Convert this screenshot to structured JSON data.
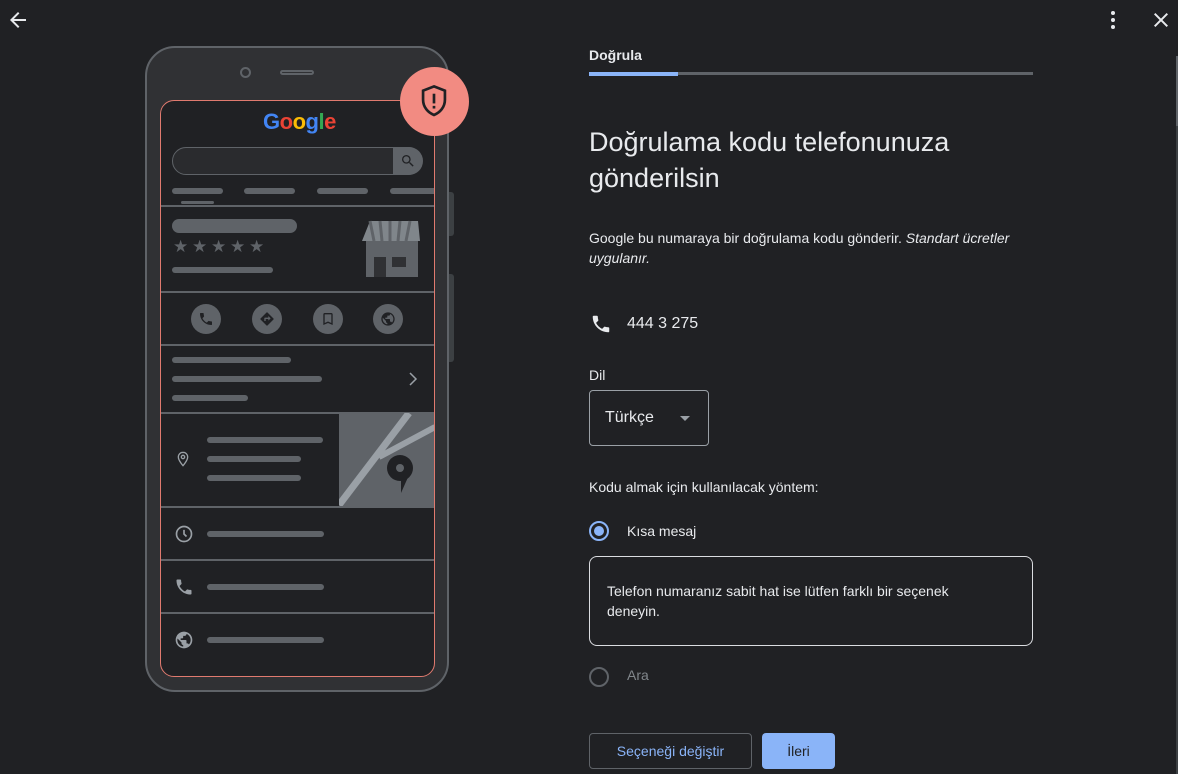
{
  "window": {
    "back_icon": "arrow-left-icon",
    "more_icon": "more-vert-icon",
    "close_icon": "close-icon"
  },
  "illustration": {
    "logo_text": [
      "G",
      "o",
      "o",
      "g",
      "l",
      "e"
    ],
    "logo_colors": [
      "#4285f4",
      "#ea4335",
      "#fbbc05",
      "#4285f4",
      "#34a853",
      "#ea4335"
    ],
    "stars": [
      "★",
      "★",
      "★",
      "★",
      "★"
    ],
    "badge_icon": "shield-icon",
    "badge_color": "#f28b82",
    "frame_color": "#e07a6f"
  },
  "stepper": {
    "label": "Doğrula",
    "progress": 0.2
  },
  "main": {
    "title": "Doğrulama kodu telefonunuza gönderilsin",
    "description": "Google bu numaraya bir doğrulama kodu gönderir.",
    "description_italic": "Standart ücretler uygulanır.",
    "phone_number": "444 3 275",
    "phone_icon": "phone-icon"
  },
  "language": {
    "label": "Dil",
    "selected": "Türkçe"
  },
  "method": {
    "label": "Kodu almak için kullanılacak yöntem:",
    "options": [
      {
        "label": "Kısa mesaj",
        "selected": true
      },
      {
        "label": "Ara",
        "selected": false
      }
    ],
    "warning": "Telefon numaranız sabit hat ise lütfen farklı bir seçenek deneyin."
  },
  "actions": {
    "change_option": "Seçeneği değiştir",
    "next": "İleri"
  },
  "colors": {
    "accent": "#8ab4f8",
    "background": "#202124"
  }
}
